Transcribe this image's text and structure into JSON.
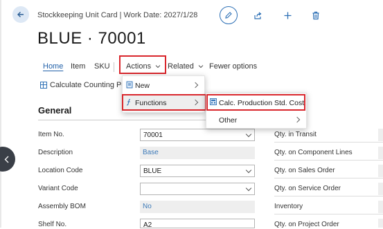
{
  "header": {
    "window_title": "Stockkeeping Unit Card | Work Date: 2027/1/28",
    "page_title": "BLUE · 70001"
  },
  "action_bar": {
    "home": "Home",
    "item": "Item",
    "sku": "SKU",
    "actions": "Actions",
    "related": "Related",
    "fewer_options": "Fewer options"
  },
  "sub_bar": {
    "calc_counting": "Calculate Counting Peri"
  },
  "actions_menu": {
    "new": "New",
    "functions": "Functions"
  },
  "functions_menu": {
    "calc_production": "Calc. Production Std. Cost",
    "other": "Other"
  },
  "section": {
    "title": "General"
  },
  "fields": [
    {
      "label": "Item No.",
      "value": "70001",
      "type": "dropdown"
    },
    {
      "label": "Description",
      "value": "Base",
      "type": "readonly"
    },
    {
      "label": "Location Code",
      "value": "BLUE",
      "type": "dropdown"
    },
    {
      "label": "Variant Code",
      "value": "",
      "type": "dropdown"
    },
    {
      "label": "Assembly BOM",
      "value": "No",
      "type": "readonly"
    },
    {
      "label": "Shelf No.",
      "value": "A2",
      "type": "input"
    }
  ],
  "right_fields": [
    {
      "label": "Qty. in Transit"
    },
    {
      "label": "Qty. on Component Lines"
    },
    {
      "label": "Qty. on Sales Order"
    },
    {
      "label": "Qty. on Service Order"
    },
    {
      "label": "Inventory"
    },
    {
      "label": "Qty. on Project Order"
    }
  ],
  "icons": [
    "back-arrow-icon",
    "pencil-icon",
    "share-icon",
    "plus-icon",
    "trash-icon",
    "grid-icon",
    "new-doc-icon",
    "function-icon",
    "calc-icon",
    "chevron-left-icon"
  ],
  "colors": {
    "accent": "#2c6fb5",
    "highlight": "#d9262c",
    "readonly_bg": "#eeeeee",
    "readonly_text": "#3d7ab8"
  }
}
